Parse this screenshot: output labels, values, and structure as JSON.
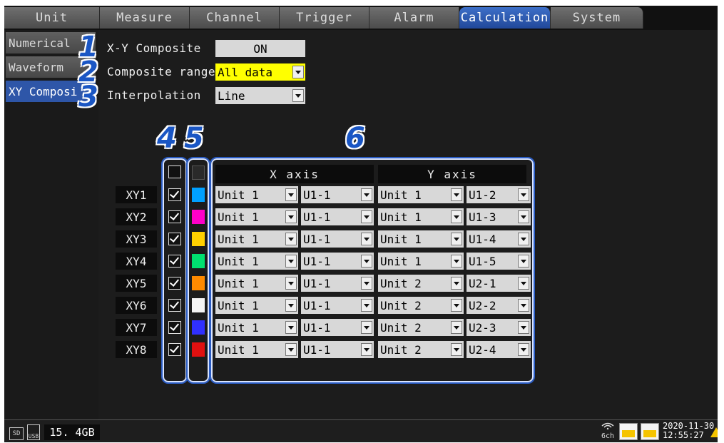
{
  "tabs": [
    "Unit",
    "Measure",
    "Channel",
    "Trigger",
    "Alarm",
    "Calculation",
    "System"
  ],
  "active_tab": "Calculation",
  "sidebar": [
    "Numerical",
    "Waveform",
    "XY Composi"
  ],
  "settings": {
    "xy_composite": {
      "label": "X-Y Composite",
      "value": "ON"
    },
    "composite_range": {
      "label": "Composite range",
      "value": "All data"
    },
    "interpolation": {
      "label": "Interpolation",
      "value": "Line"
    }
  },
  "callouts": [
    "1",
    "2",
    "3",
    "4",
    "5",
    "6"
  ],
  "table": {
    "x_axis_header": "X axis",
    "y_axis_header": "Y axis",
    "rows": [
      {
        "label": "XY1",
        "color": "#00a0ff",
        "x_unit": "Unit 1",
        "x_ch": "U1-1",
        "y_unit": "Unit 1",
        "y_ch": "U1-2"
      },
      {
        "label": "XY2",
        "color": "#ff00c8",
        "x_unit": "Unit 1",
        "x_ch": "U1-1",
        "y_unit": "Unit 1",
        "y_ch": "U1-3"
      },
      {
        "label": "XY3",
        "color": "#ffd000",
        "x_unit": "Unit 1",
        "x_ch": "U1-1",
        "y_unit": "Unit 1",
        "y_ch": "U1-4"
      },
      {
        "label": "XY4",
        "color": "#00e070",
        "x_unit": "Unit 1",
        "x_ch": "U1-1",
        "y_unit": "Unit 1",
        "y_ch": "U1-5"
      },
      {
        "label": "XY5",
        "color": "#ff8a00",
        "x_unit": "Unit 1",
        "x_ch": "U1-1",
        "y_unit": "Unit 2",
        "y_ch": "U2-1"
      },
      {
        "label": "XY6",
        "color": "#f4f4f4",
        "x_unit": "Unit 1",
        "x_ch": "U1-1",
        "y_unit": "Unit 2",
        "y_ch": "U2-2"
      },
      {
        "label": "XY7",
        "color": "#3030ff",
        "x_unit": "Unit 1",
        "x_ch": "U1-1",
        "y_unit": "Unit 2",
        "y_ch": "U2-3"
      },
      {
        "label": "XY8",
        "color": "#e01010",
        "x_unit": "Unit 1",
        "x_ch": "U1-1",
        "y_unit": "Unit 2",
        "y_ch": "U2-4"
      }
    ]
  },
  "status": {
    "sd": "SD",
    "usb": "USB",
    "storage": "15. 4GB",
    "channels": "6ch",
    "date": "2020-11-30",
    "time": "12:55:27"
  }
}
